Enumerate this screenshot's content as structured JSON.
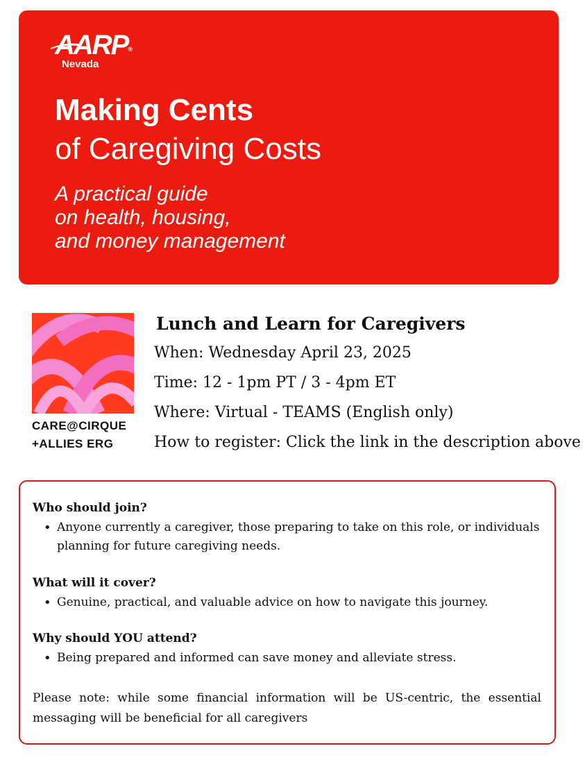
{
  "banner": {
    "logo_text": "AARP",
    "logo_sub": "Nevada",
    "title_line1": "Making Cents",
    "title_line2": "of Caregiving Costs",
    "tagline": [
      "A practical guide",
      "on health, housing,",
      "and money management"
    ]
  },
  "organizer": {
    "line1": "CARE@CIRQUE",
    "line2": "+ALLIES ERG"
  },
  "event": {
    "title": "Lunch and Learn for Caregivers",
    "when": "When: Wednesday April 23, 2025",
    "time": "Time: 12 - 1pm PT / 3 - 4pm ET",
    "where": "Where: Virtual - TEAMS (English only)",
    "register": "How to register: Click the link in the description above"
  },
  "info": {
    "sections": [
      {
        "question": "Who should join?",
        "answer": "Anyone currently a caregiver, those preparing to take on this role, or individuals planning for future caregiving needs."
      },
      {
        "question": "What will it cover?",
        "answer": "Genuine, practical, and valuable advice on how to navigate this journey."
      },
      {
        "question": "Why should YOU attend?",
        "answer": "Being prepared and informed can save money and alleviate stress."
      }
    ],
    "note": "Please note: while some financial information will be US-centric, the essential messaging will be beneficial for all caregivers"
  },
  "colors": {
    "banner_red": "#ec1b0f",
    "box_border": "#d21a1a",
    "emblem_pink": "#f06fc0"
  },
  "icons": {
    "logo": "aarp-logo",
    "emblem": "arches-emblem"
  }
}
